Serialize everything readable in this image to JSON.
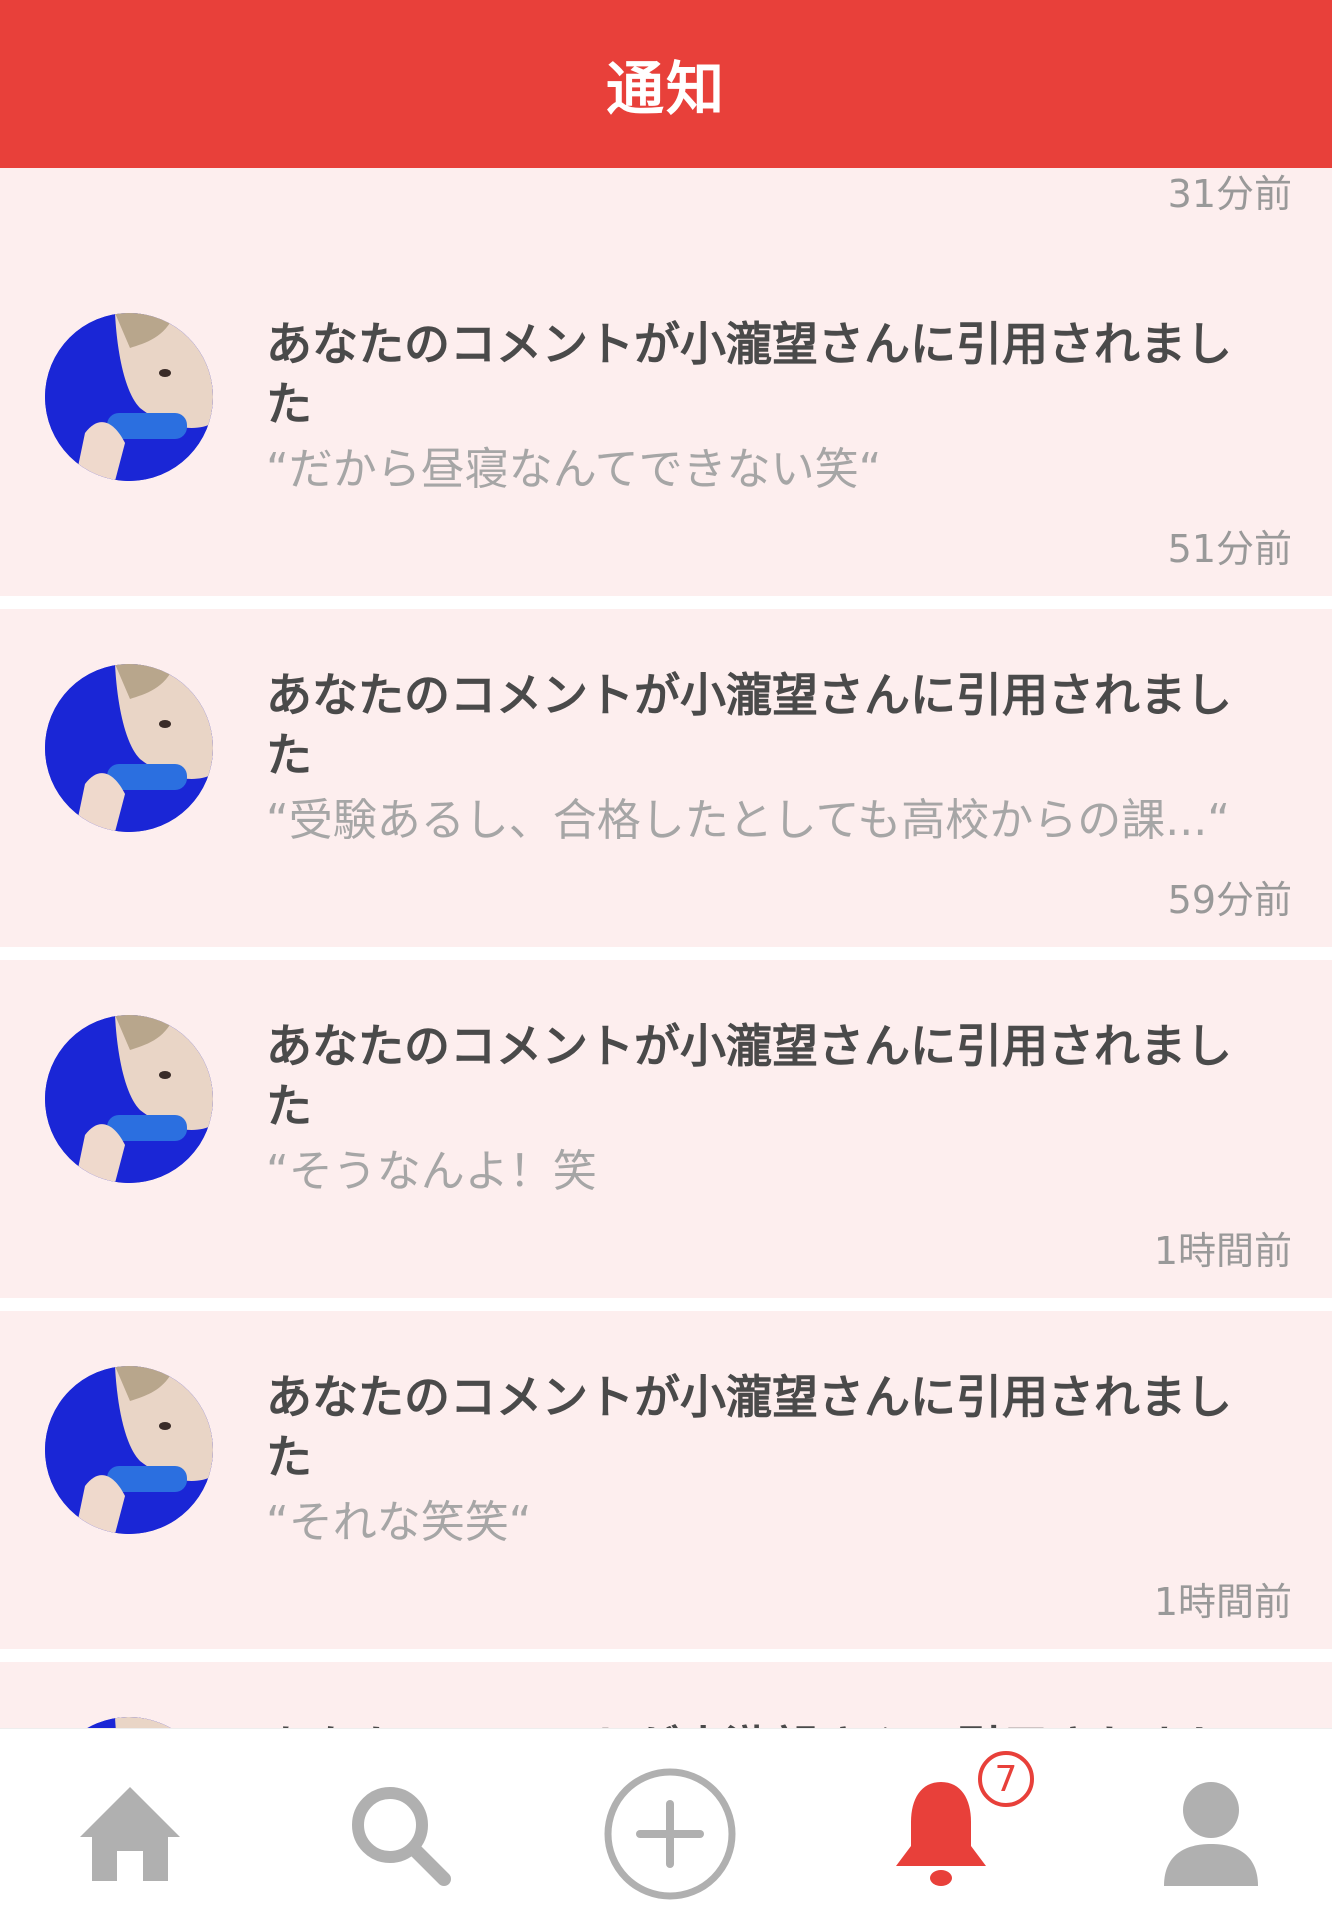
{
  "header": {
    "title": "通知"
  },
  "top_partial": {
    "time": "31分前"
  },
  "notifications": [
    {
      "title": "あなたのコメントが小瀧望さんに引用されました",
      "quote": "“だから昼寝なんてできない笑“",
      "time": "51分前"
    },
    {
      "title": "あなたのコメントが小瀧望さんに引用されました",
      "quote": "“受験あるし、合格したとしても高校からの課...“",
      "time": "59分前"
    },
    {
      "title": "あなたのコメントが小瀧望さんに引用されました",
      "quote": "“そうなんよ！笑",
      "time": "1時間前"
    },
    {
      "title": "あなたのコメントが小瀧望さんに引用されました",
      "quote": "“それな笑笑“",
      "time": "1時間前"
    }
  ],
  "bottom_partial": {
    "title": "あなたのコメントが小瀧望さんに引用されました"
  },
  "tabbar": {
    "tabs": [
      {
        "icon": "home-icon"
      },
      {
        "icon": "search-icon"
      },
      {
        "icon": "add-icon"
      },
      {
        "icon": "bell-icon"
      },
      {
        "icon": "profile-icon"
      }
    ],
    "notification_badge": "7"
  },
  "colors": {
    "accent": "#e8403a",
    "card_background": "#fdeeee",
    "title_text": "#4a4a4a",
    "secondary_text": "#a6a6a6",
    "inactive_icon": "#b0b0b0"
  }
}
